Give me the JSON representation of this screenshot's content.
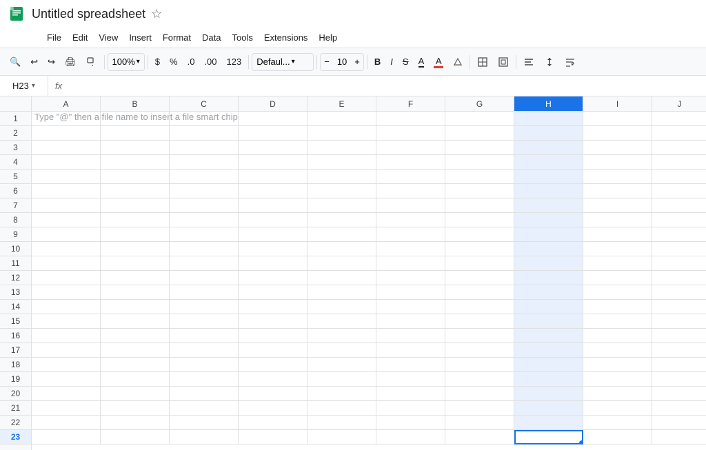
{
  "titleBar": {
    "appName": "Untitled spreadsheet",
    "starLabel": "☆"
  },
  "menuBar": {
    "items": [
      "File",
      "Edit",
      "View",
      "Insert",
      "Format",
      "Data",
      "Tools",
      "Extensions",
      "Help"
    ]
  },
  "toolbar": {
    "searchIcon": "🔍",
    "undoIcon": "↩",
    "redoIcon": "↪",
    "printIcon": "🖨",
    "formatPaintIcon": "🖌",
    "zoomLabel": "100%",
    "zoomChevron": "▾",
    "dollarLabel": "$",
    "percentLabel": "%",
    "decDecimals": ".0",
    "incDecimals": ".00",
    "numFormat": "123",
    "fontName": "Defaul...",
    "fontChevron": "▾",
    "minusLabel": "−",
    "fontSize": "10",
    "plusLabel": "+",
    "boldLabel": "B",
    "italicLabel": "I",
    "strikeLabel": "S̶",
    "underlineLabel": "A",
    "fillColorIcon": "A",
    "borderIcon": "⊞",
    "mergeIcon": "⊡",
    "alignIcon": "≡",
    "valignIcon": "↕",
    "wrapIcon": "↵"
  },
  "formulaBar": {
    "cellRef": "H23",
    "chevron": "▾",
    "fxLabel": "fx"
  },
  "grid": {
    "columns": [
      "A",
      "B",
      "C",
      "D",
      "E",
      "F",
      "G",
      "H",
      "I",
      "J"
    ],
    "selectedCol": "H",
    "selectedRow": 23,
    "rows": 23,
    "hintText": "Type \"@\" then a file name to insert a file smart chip",
    "activeCell": {
      "row": 23,
      "col": "H"
    }
  }
}
